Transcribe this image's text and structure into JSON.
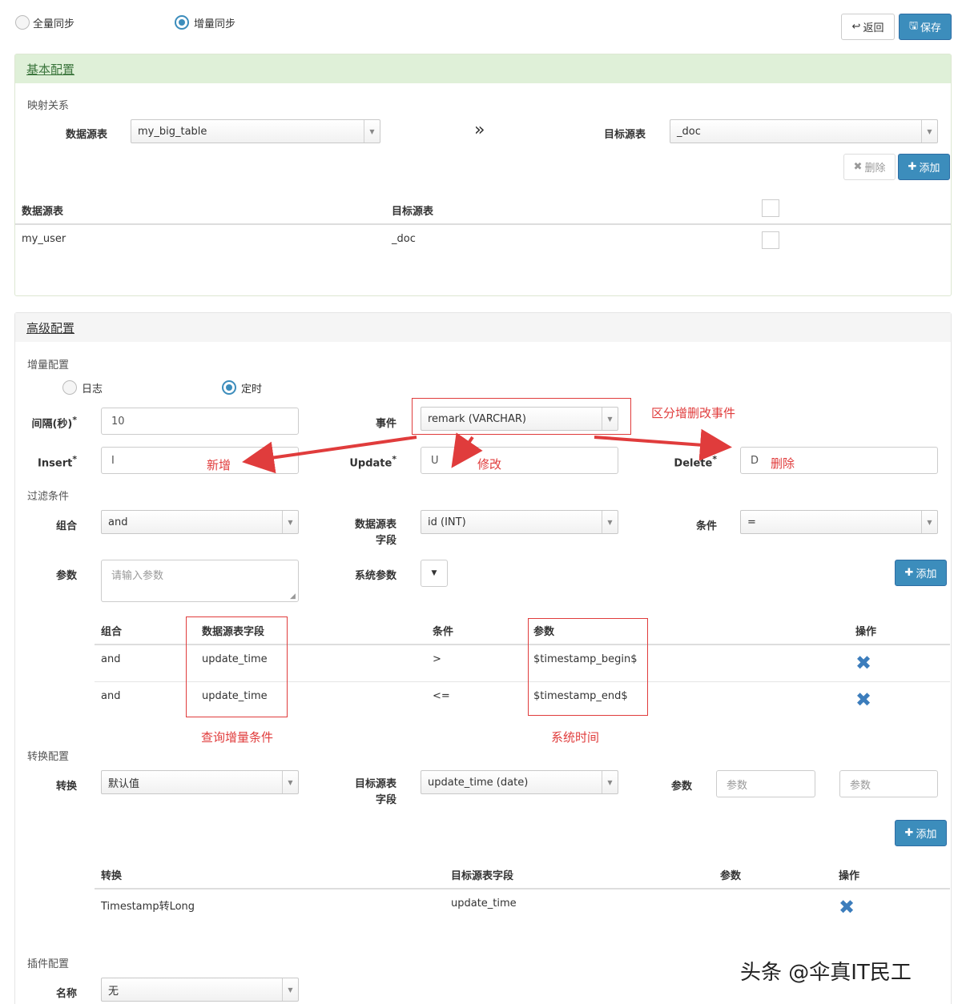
{
  "sync_mode": {
    "full_label": "全量同步",
    "incremental_label": "增量同步",
    "selected": "incremental"
  },
  "toolbar": {
    "back_label": "返回",
    "save_label": "保存"
  },
  "basic": {
    "title": "基本配置",
    "mapping_label": "映射关系",
    "source_label": "数据源表",
    "source_value": "my_big_table",
    "target_label": "目标源表",
    "target_value": "_doc",
    "delete_label": "删除",
    "add_label": "添加",
    "table": {
      "headers": [
        "数据源表",
        "目标源表"
      ],
      "rows": [
        {
          "source": "my_user",
          "target": "_doc"
        }
      ]
    }
  },
  "advanced": {
    "title": "高级配置",
    "incremental_label": "增量配置",
    "mode_log": "日志",
    "mode_timer": "定时",
    "mode_selected": "timer",
    "interval_label": "间隔(秒)",
    "interval_value": "10",
    "event_label": "事件",
    "event_value": "remark (VARCHAR)",
    "insert_label": "Insert",
    "insert_value": "I",
    "update_label": "Update",
    "update_value": "U",
    "delete_label": "Delete",
    "delete_value": "D",
    "filter_label": "过滤条件",
    "combine_label": "组合",
    "combine_value": "and",
    "source_field_label_1": "数据源表",
    "source_field_label_2": "字段",
    "source_field_value": "id (INT)",
    "condition_label": "条件",
    "condition_value": "=",
    "param_label": "参数",
    "param_placeholder": "请输入参数",
    "sys_param_label": "系统参数",
    "add_label": "添加",
    "filter_table": {
      "headers": [
        "组合",
        "数据源表字段",
        "条件",
        "参数",
        "操作"
      ],
      "rows": [
        {
          "combine": "and",
          "field": "update_time",
          "cond": ">",
          "param": "$timestamp_begin$"
        },
        {
          "combine": "and",
          "field": "update_time",
          "cond": "<=",
          "param": "$timestamp_end$"
        }
      ]
    },
    "convert_label": "转换配置",
    "convert_type_label": "转换",
    "convert_type_value": "默认值",
    "target_field_label_1": "目标源表",
    "target_field_label_2": "字段",
    "target_field_value": "update_time (date)",
    "convert_param_label": "参数",
    "convert_param_ph1": "参数",
    "convert_param_ph2": "参数",
    "convert_table": {
      "headers": [
        "转换",
        "目标源表字段",
        "参数",
        "操作"
      ],
      "rows": [
        {
          "type": "Timestamp转Long",
          "field": "update_time",
          "param": ""
        }
      ]
    },
    "plugin_label": "插件配置",
    "plugin_name_label": "名称",
    "plugin_name_value": "无"
  },
  "annotations": {
    "event_note": "区分增删改事件",
    "insert_note": "新增",
    "update_note": "修改",
    "delete_note": "删除",
    "field_note": "查询增量条件",
    "param_note": "系统时间"
  },
  "watermark": "头条 @伞真IT民工",
  "colors": {
    "primary": "#3c8dbc",
    "panel_head": "#dff0d8",
    "annotation": "#e03c3c"
  }
}
